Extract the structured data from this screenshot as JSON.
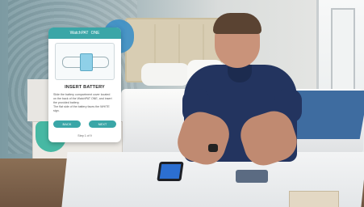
{
  "card": {
    "header": {
      "app_name": "WatchPAT",
      "app_suffix": "ONE"
    },
    "title": "INSERT BATTERY",
    "body_lines": [
      "Slide the battery compartment cover located",
      "on the back of the WatchPAT ONE, and insert",
      "the provided battery.",
      "The flat side of the battery faces the WHITE sign."
    ],
    "buttons": {
      "back": "BACK",
      "next": "NEXT"
    },
    "footer": "Step 1 of 9"
  },
  "colors": {
    "accent": "#3aa6a7",
    "teal_shape": "#35b39b",
    "blue_shape": "#3b8fc6",
    "shirt": "#23345f"
  }
}
